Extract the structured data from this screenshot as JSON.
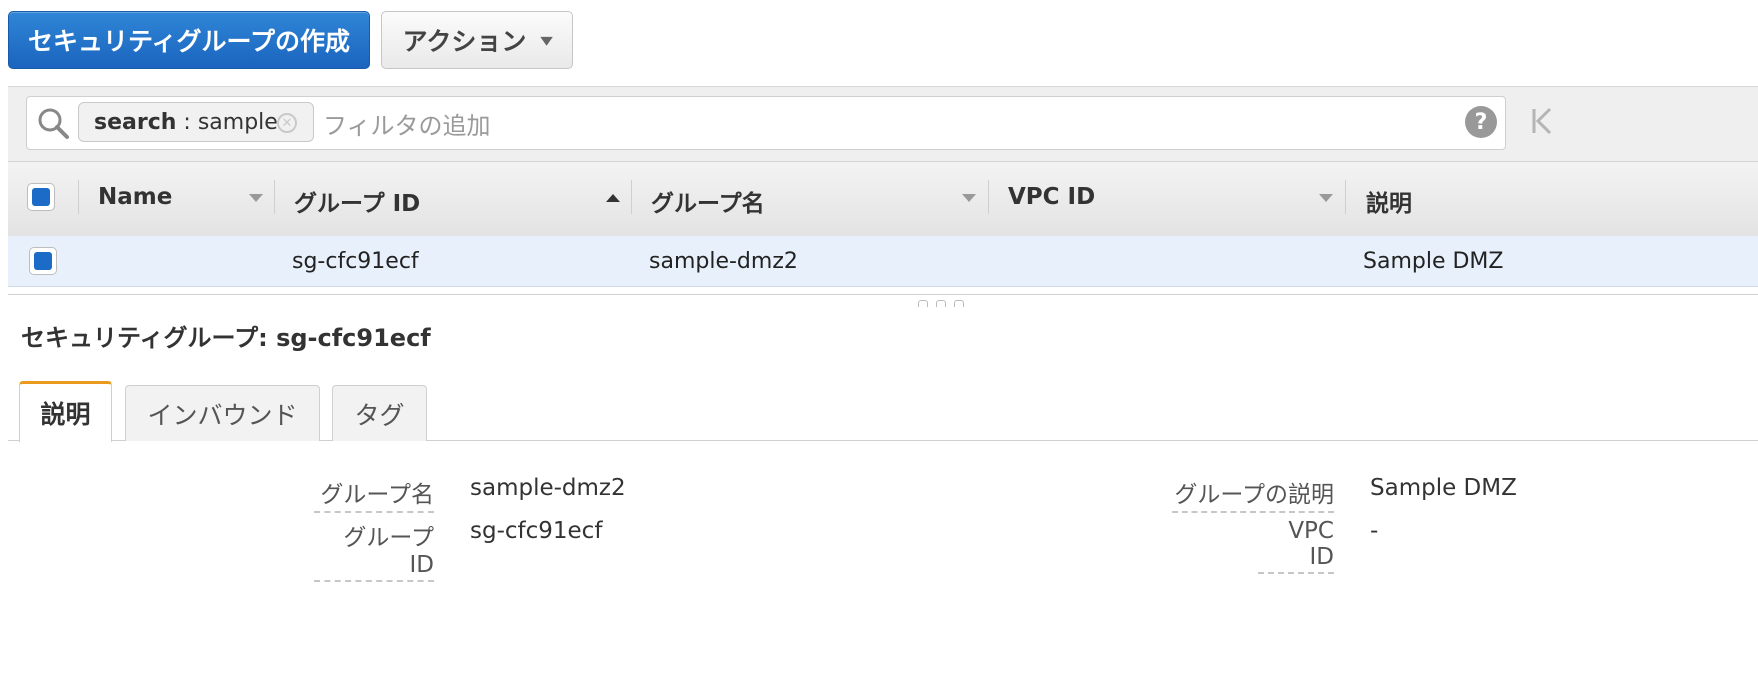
{
  "toolbar": {
    "create_label": "セキュリティグループの作成",
    "action_label": "アクション",
    "action_chevron": "⌄"
  },
  "search": {
    "token_key": "search",
    "token_sep": " : ",
    "token_value": "sample",
    "placeholder": "フィルタの追加",
    "help": "?",
    "first_page": "|<"
  },
  "table": {
    "columns": [
      "Name",
      "グループ ID",
      "グループ名",
      "VPC ID",
      "説明"
    ],
    "rows": [
      {
        "name": "",
        "group_id": "sg-cfc91ecf",
        "group_name": "sample-dmz2",
        "vpc_id": "",
        "description": "Sample DMZ"
      }
    ]
  },
  "details": {
    "title": "セキュリティグループ: sg-cfc91ecf",
    "tabs": [
      "説明",
      "インバウンド",
      "タグ"
    ],
    "left": [
      {
        "label": "グループ名",
        "value": "sample-dmz2"
      },
      {
        "label": "グループ ID",
        "value": "sg-cfc91ecf"
      }
    ],
    "right": [
      {
        "label": "グループの説明",
        "value": "Sample DMZ"
      },
      {
        "label": "VPC ID",
        "value": "-"
      }
    ]
  },
  "colors": {
    "primary": "#1b64bf",
    "selected_row": "#e8f1fb",
    "active_tab_accent": "#e99a1f"
  }
}
